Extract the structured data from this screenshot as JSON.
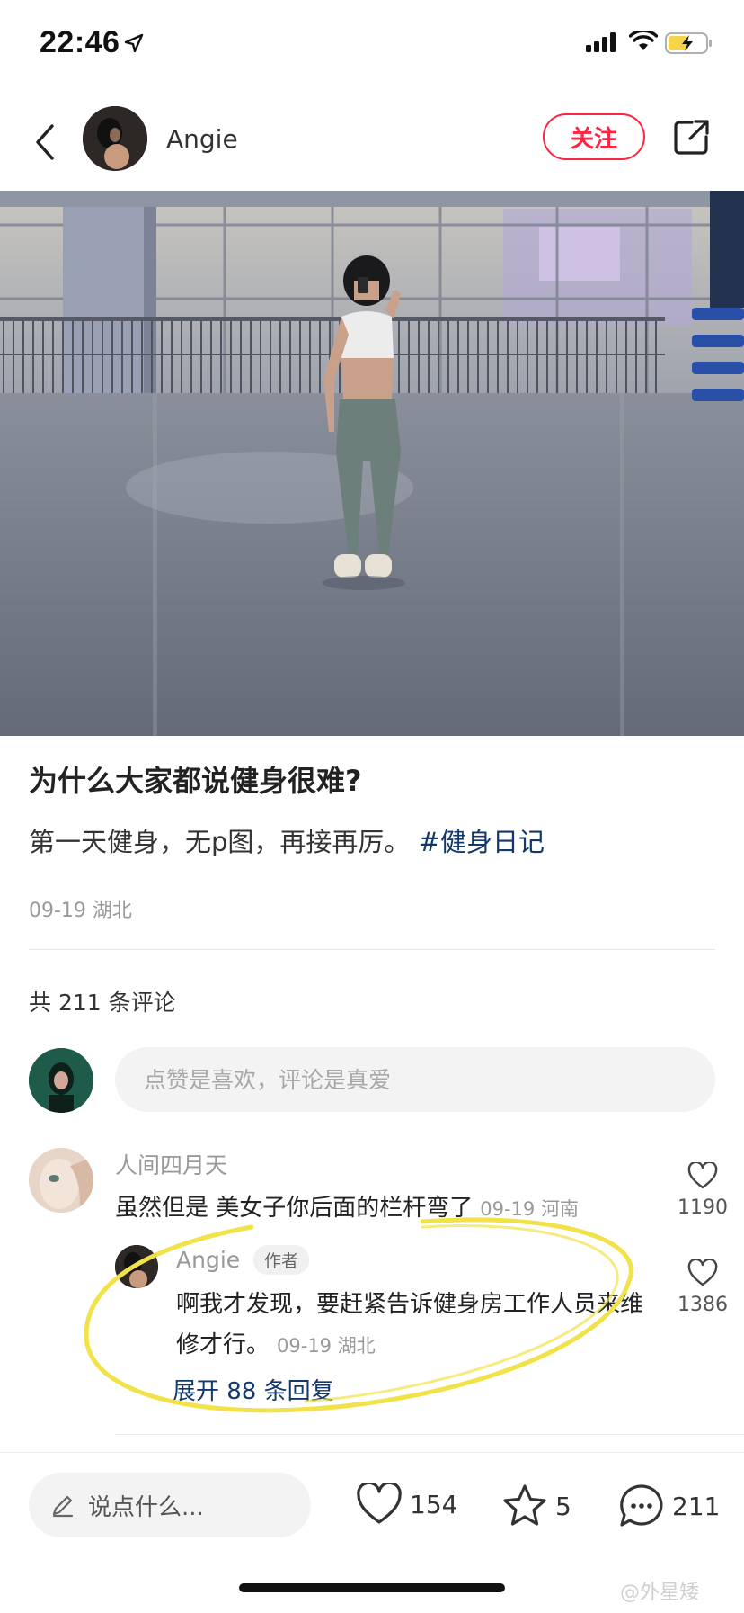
{
  "status_bar": {
    "time": "22:46",
    "icons": [
      "location-arrow-icon",
      "signal-icon",
      "wifi-icon",
      "battery-charging-icon"
    ],
    "battery_color": "#f5d547"
  },
  "header": {
    "username": "Angie",
    "follow_label": "关注",
    "icons": [
      "back-icon",
      "share-icon"
    ]
  },
  "post": {
    "title": "为什么大家都说健身很难?",
    "body": "第一天健身，无p图，再接再厉。",
    "hashtag": "#健身日记",
    "date": "09-19",
    "location": "湖北",
    "meta": "09-19 湖北"
  },
  "comments_section": {
    "count_label": "共 211 条评论",
    "input_placeholder": "点赞是喜欢，评论是真爱",
    "comments": [
      {
        "name": "人间四月天",
        "text": "虽然但是 美女子你后面的栏杆弯了",
        "meta": "09-19 河南",
        "likes": "1190",
        "replies": [
          {
            "name": "Angie",
            "badge": "作者",
            "text": "啊我才发现，要赶紧告诉健身房工作人员来维修才行。",
            "meta": "09-19 湖北",
            "likes": "1386"
          }
        ],
        "expand_label": "展开 88 条回复"
      }
    ]
  },
  "bottom_bar": {
    "input_label": "说点什么...",
    "likes": "154",
    "stars": "5",
    "comments": "211"
  },
  "watermark": "@外星矮",
  "colors": {
    "accent": "#ff2442",
    "link": "#13386c",
    "muted": "#999999",
    "highlight": "#f2e24a"
  }
}
